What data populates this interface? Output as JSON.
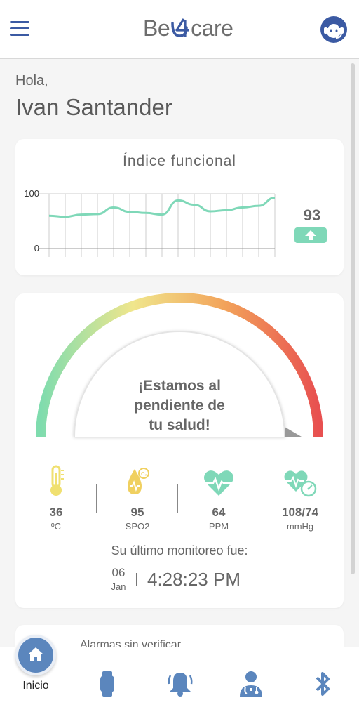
{
  "header": {
    "logo_prefix": "Be",
    "logo_suffix": "care",
    "menu_icon": "hamburger-menu-icon",
    "support_icon": "headset-support-icon"
  },
  "greeting": {
    "hello": "Hola,",
    "user_name": "Ivan Santander"
  },
  "functional_index": {
    "title": "Índice funcional",
    "current_value": "93",
    "trend_icon": "arrow-up-icon",
    "chart_data": {
      "type": "line",
      "title": "Índice funcional",
      "x": [
        0,
        1,
        2,
        3,
        4,
        5,
        6,
        7,
        8,
        9,
        10,
        11,
        12,
        13,
        14
      ],
      "values": [
        60,
        58,
        62,
        63,
        75,
        67,
        65,
        62,
        88,
        80,
        68,
        70,
        75,
        78,
        93
      ],
      "ylim": [
        0,
        100
      ],
      "ytick_labels": [
        "0",
        "100"
      ],
      "grid": true,
      "colors": {
        "line": "#7fd8b8",
        "grid": "#cccccc"
      }
    }
  },
  "status_card": {
    "gauge_message_line1": "¡Estamos al",
    "gauge_message_line2": "pendiente de",
    "gauge_message_line3": "tu salud!",
    "gauge_colors": [
      "#7fdcae",
      "#f0e68c",
      "#f2a25a",
      "#e85050"
    ],
    "vitals": [
      {
        "icon": "thermometer-icon",
        "value": "36",
        "unit": "ºC",
        "color": "#f0e070"
      },
      {
        "icon": "oxygen-drop-icon",
        "value": "95",
        "unit": "SPO2",
        "color": "#f0d060"
      },
      {
        "icon": "heart-pulse-icon",
        "value": "64",
        "unit": "PPM",
        "color": "#7fd8b8"
      },
      {
        "icon": "blood-pressure-icon",
        "value": "108/74",
        "unit": "mmHg",
        "color": "#7fd8b8"
      }
    ],
    "last_monitoring_label": "Su último monitoreo fue:",
    "date_day": "06",
    "date_month": "Jan",
    "time": "4:28:23 PM"
  },
  "alarms_card": {
    "label": "Alarmas sin verificar"
  },
  "bottom_nav": {
    "home_label": "Inicio",
    "items": [
      "home-icon",
      "smartwatch-icon",
      "bell-icon",
      "doctor-icon",
      "bluetooth-icon"
    ],
    "active_color": "#5b86bd"
  }
}
